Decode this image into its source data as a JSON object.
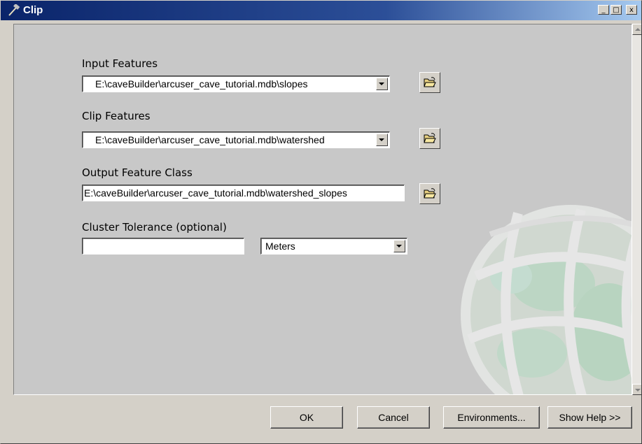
{
  "window": {
    "title": "Clip",
    "minimize_glyph": "_",
    "maximize_glyph": "□",
    "close_glyph": "x"
  },
  "form": {
    "input_features": {
      "label": "Input Features",
      "value": "E:\\caveBuilder\\arcuser_cave_tutorial.mdb\\slopes"
    },
    "clip_features": {
      "label": "Clip Features",
      "value": "E:\\caveBuilder\\arcuser_cave_tutorial.mdb\\watershed"
    },
    "output_feature_class": {
      "label": "Output Feature Class",
      "value": "E:\\caveBuilder\\arcuser_cave_tutorial.mdb\\watershed_slopes"
    },
    "cluster_tolerance": {
      "label": "Cluster Tolerance (optional)",
      "value": "",
      "units": "Meters"
    }
  },
  "buttons": {
    "ok": "OK",
    "cancel": "Cancel",
    "environments": "Environments...",
    "show_help": "Show Help >>"
  },
  "icons": {
    "title": "hammer-icon",
    "browse": "folder-open-icon",
    "background": "globe-watermark"
  }
}
